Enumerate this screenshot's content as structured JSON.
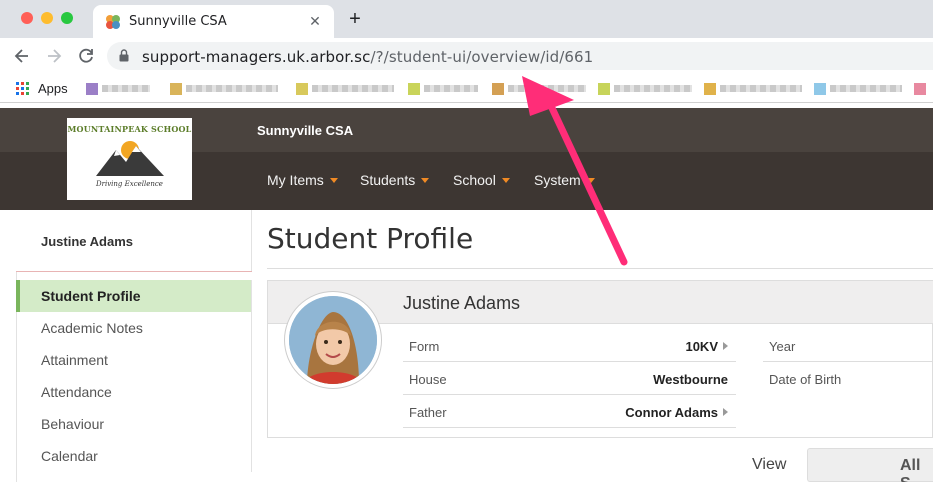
{
  "browser": {
    "tab_title": "Sunnyville CSA",
    "tab_close": "✕",
    "new_tab": "+",
    "url_host": "support-managers.uk.arbor.sc",
    "url_path": "/?/student-ui/overview/id/661",
    "bookmarks_apps_label": "Apps",
    "icons": {
      "back": "arrow-left-icon",
      "forward": "arrow-right-icon",
      "reload": "reload-icon",
      "lock": "lock-icon"
    }
  },
  "header": {
    "school_name": "Sunnyville CSA",
    "logo_title": "MOUNTAINPEAK SCHOOL",
    "logo_tagline": "Driving Excellence",
    "menu": [
      {
        "label": "My Items"
      },
      {
        "label": "Students"
      },
      {
        "label": "School"
      },
      {
        "label": "System"
      }
    ],
    "colors": {
      "header_dark": "#3d3632",
      "header_upper": "#4a433e",
      "caret": "#f08a24"
    }
  },
  "sidebar": {
    "student_name": "Justine Adams",
    "items": [
      {
        "label": "Student Profile",
        "active": true
      },
      {
        "label": "Academic Notes"
      },
      {
        "label": "Attainment"
      },
      {
        "label": "Attendance"
      },
      {
        "label": "Behaviour"
      },
      {
        "label": "Calendar"
      }
    ],
    "active_color": "#d4ebc8"
  },
  "main": {
    "page_title": "Student Profile",
    "profile": {
      "name": "Justine Adams",
      "fields_left": [
        {
          "label": "Form",
          "value": "10KV",
          "linked": true
        },
        {
          "label": "House",
          "value": "Westbourne",
          "linked": false
        },
        {
          "label": "Father",
          "value": "Connor Adams",
          "linked": true
        }
      ],
      "fields_right": [
        {
          "label": "Year",
          "value": ""
        },
        {
          "label": "Date of Birth",
          "value": ""
        }
      ]
    },
    "view_label": "View",
    "view_select_value": "All S"
  },
  "annotation": {
    "arrow_color": "#ff2d78"
  }
}
